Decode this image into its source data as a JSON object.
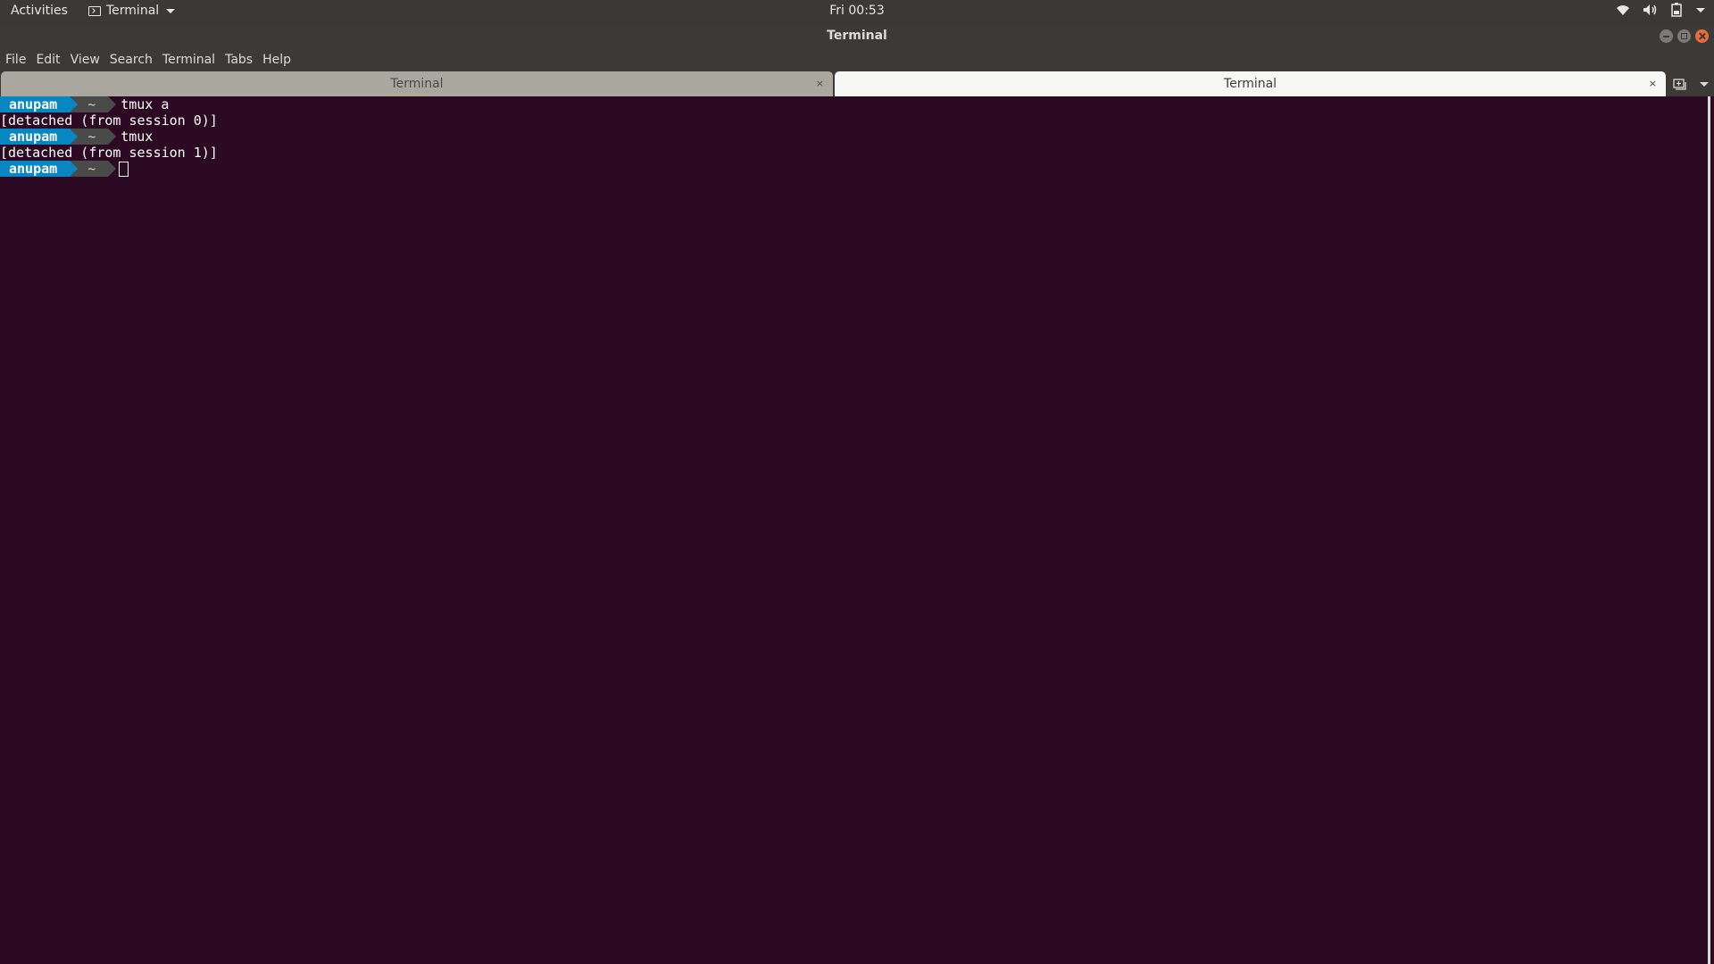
{
  "top_panel": {
    "activities": "Activities",
    "app_menu_label": "Terminal",
    "clock": "Fri 00:53",
    "tray_icons": [
      "wifi-icon",
      "volume-icon",
      "battery-icon",
      "system-menu-caret-icon"
    ]
  },
  "window": {
    "title": "Terminal",
    "controls": [
      "minimize",
      "maximize",
      "close"
    ]
  },
  "menubar": {
    "items": [
      "File",
      "Edit",
      "View",
      "Search",
      "Terminal",
      "Tabs",
      "Help"
    ]
  },
  "tabs": [
    {
      "label": "Terminal",
      "active": false,
      "close": "×"
    },
    {
      "label": "Terminal",
      "active": true,
      "close": "×"
    }
  ],
  "terminal": {
    "lines": [
      {
        "type": "prompt",
        "user": "anupam",
        "dir": "~",
        "command": "tmux a"
      },
      {
        "type": "output",
        "text": "[detached (from session 0)]"
      },
      {
        "type": "prompt",
        "user": "anupam",
        "dir": "~",
        "command": "tmux"
      },
      {
        "type": "output",
        "text": "[detached (from session 1)]"
      },
      {
        "type": "prompt",
        "user": "anupam",
        "dir": "~",
        "command": ""
      }
    ]
  },
  "colors": {
    "terminal_bg": "#2c0a24",
    "prompt_user_bg": "#0687c2",
    "prompt_dir_bg": "#4a4a4a",
    "panel_bg": "#3a3937",
    "close_button": "#ef6a3b"
  }
}
